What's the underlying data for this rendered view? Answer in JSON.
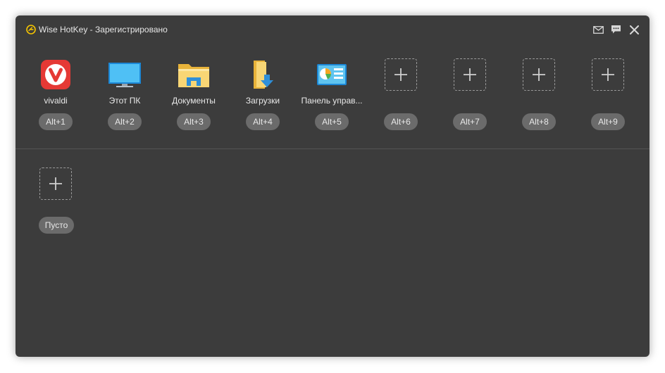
{
  "window": {
    "title": "Wise HotKey - Зарегистрировано",
    "accent": "#f5c400",
    "background": "#3c3c3c"
  },
  "titlebar_buttons": [
    {
      "icon": "mail-icon"
    },
    {
      "icon": "chat-icon"
    },
    {
      "icon": "close-icon"
    }
  ],
  "slots": [
    {
      "label": "vivaldi",
      "hotkey": "Alt+1",
      "icon": "vivaldi-icon"
    },
    {
      "label": "Этот ПК",
      "hotkey": "Alt+2",
      "icon": "monitor-icon"
    },
    {
      "label": "Документы",
      "hotkey": "Alt+3",
      "icon": "folder-icon"
    },
    {
      "label": "Загрузки",
      "hotkey": "Alt+4",
      "icon": "downloads-folder-icon"
    },
    {
      "label": "Панель управ...",
      "hotkey": "Alt+5",
      "icon": "control-panel-icon"
    },
    {
      "label": "",
      "hotkey": "Alt+6",
      "icon": "add-icon"
    },
    {
      "label": "",
      "hotkey": "Alt+7",
      "icon": "add-icon"
    },
    {
      "label": "",
      "hotkey": "Alt+8",
      "icon": "add-icon"
    },
    {
      "label": "",
      "hotkey": "Alt+9",
      "icon": "add-icon"
    }
  ],
  "second_row": {
    "empty_label": "Пусто",
    "icon": "add-icon"
  }
}
